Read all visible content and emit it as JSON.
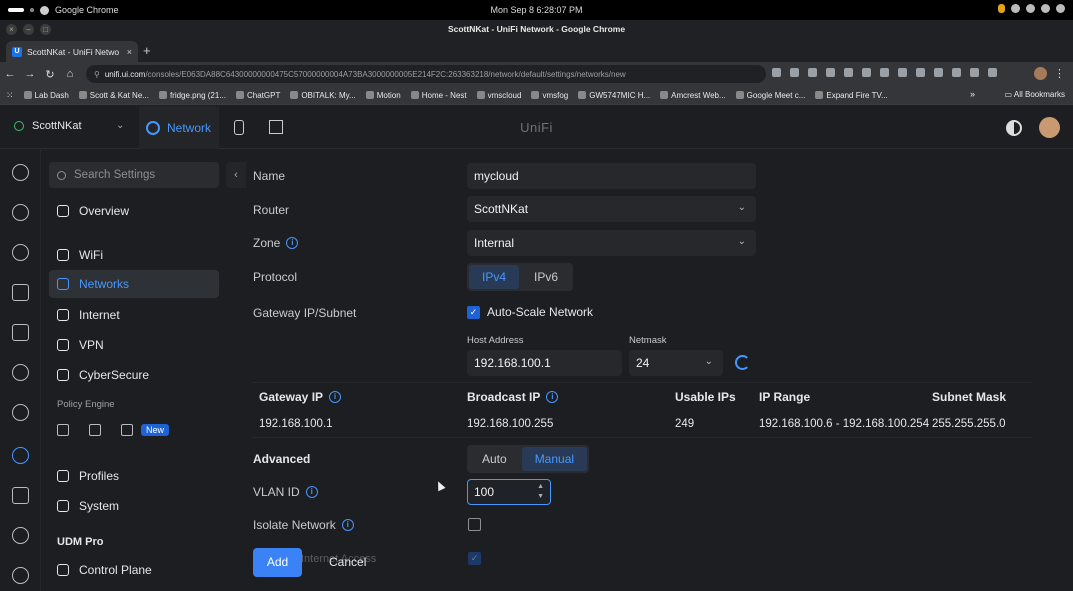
{
  "os": {
    "app": "Google Chrome",
    "clock": "Mon Sep 8   6:28:07 PM"
  },
  "window": {
    "title": "ScottNKat - UniFi Network - Google Chrome"
  },
  "tab": {
    "label": "ScottNKat - UniFi Netwo",
    "favicon": "U"
  },
  "omnibox": {
    "host": "unifi.ui.com",
    "path": "/consoles/E063DA88C64300000000475C57000000004A73BA3000000005E214F2C:263363218/network/default/settings/networks/new"
  },
  "bookmarks": [
    "Lab Dash",
    "Scott & Kat Ne...",
    "fridge.png (21...",
    "ChatGPT",
    "OBITALK: My...",
    "Motion",
    "Home - Nest",
    "vmscloud",
    "vmsfog",
    "GW5747MIC H...",
    "Amcrest Web...",
    "Google Meet c...",
    "Expand Fire TV..."
  ],
  "bookmarks_more": "»",
  "bookmarks_all": "All Bookmarks",
  "header": {
    "site": "ScottNKat",
    "app_tab": "Network",
    "brand": "UniFi"
  },
  "sidebar": {
    "search_placeholder": "Search Settings",
    "items": [
      "Overview",
      "WiFi",
      "Networks",
      "Internet",
      "VPN",
      "CyberSecure",
      "Profiles",
      "System",
      "Control Plane"
    ],
    "policy_engine": "Policy Engine",
    "new_badge": "New",
    "udm": "UDM Pro"
  },
  "form": {
    "name_label": "Name",
    "name_value": "mycloud",
    "router_label": "Router",
    "router_value": "ScottNKat",
    "zone_label": "Zone",
    "zone_value": "Internal",
    "protocol_label": "Protocol",
    "protocol_options": [
      "IPv4",
      "IPv6"
    ],
    "protocol_selected": "IPv4",
    "gateway_label": "Gateway IP/Subnet",
    "autoscale_label": "Auto-Scale Network",
    "host_label": "Host Address",
    "host_value": "192.168.100.1",
    "netmask_label": "Netmask",
    "netmask_value": "24",
    "table_headers": [
      "Gateway IP",
      "Broadcast IP",
      "Usable IPs",
      "IP Range",
      "Subnet Mask"
    ],
    "table_values": [
      "192.168.100.1",
      "192.168.100.255",
      "249",
      "192.168.100.6 - 192.168.100.254",
      "255.255.255.0"
    ],
    "advanced_label": "Advanced",
    "advanced_options": [
      "Auto",
      "Manual"
    ],
    "advanced_selected": "Manual",
    "vlan_label": "VLAN ID",
    "vlan_value": "100",
    "isolate_label": "Isolate Network",
    "internet_access_label": "Internet Access"
  },
  "actions": {
    "add": "Add",
    "cancel": "Cancel"
  },
  "colors": {
    "accent": "#4797ff",
    "button": "#3b82f6",
    "background": "#1c1e21"
  }
}
